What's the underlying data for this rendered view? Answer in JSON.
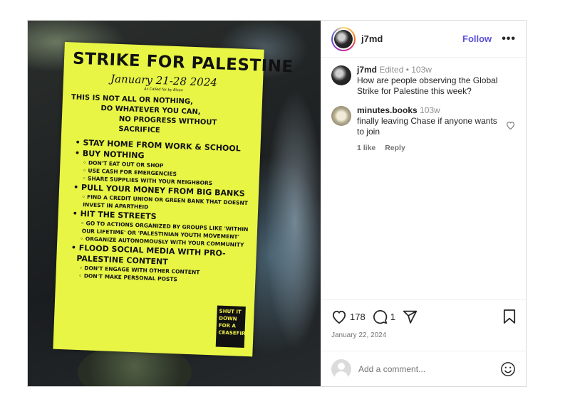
{
  "post": {
    "username": "j7md",
    "follow_label": "Follow",
    "more_label": "•••",
    "likes": "178",
    "comments_count": "1",
    "date": "January 22, 2024"
  },
  "flyer": {
    "title": "STRIKE FOR PALESTINE",
    "dates": "January 21-28 2024",
    "called_by": "As Called for by Bisan",
    "intro": [
      "THIS IS NOT ALL OR NOTHING,",
      "DO WHATEVER YOU CAN,",
      "NO PROGRESS WITHOUT SACRIFICE"
    ],
    "items": [
      "STAY HOME FROM WORK & SCHOOL",
      "BUY NOTHING",
      "DON'T EAT OUT OR SHOP",
      "USE CASH FOR EMERGENCIES",
      "SHARE SUPPLIES WITH YOUR NEIGHBORS",
      "PULL YOUR MONEY FROM BIG BANKS",
      "FIND A CREDIT UNION OR GREEN BANK THAT DOESNT",
      "INVEST IN APARTHEID",
      "HIT THE STREETS",
      "GO TO ACTIONS ORGANIZED BY GROUPS LIKE 'WITHIN",
      "OUR LIFETIME' OR 'PALESTINIAN YOUTH MOVEMENT'",
      "ORGANIZE AUTONOMOUSLY WITH YOUR COMMUNITY",
      "FLOOD SOCIAL MEDIA WITH PRO-",
      "PALESTINE CONTENT",
      "DON'T ENGAGE WITH OTHER CONTENT",
      "DON'T MAKE PERSONAL POSTS"
    ],
    "badge": "SHUT IT\nDOWN\nFOR A\nCEASEFIRE"
  },
  "comments": [
    {
      "user": "j7md",
      "meta": "Edited • 103w",
      "text": "How are people observing the Global Strike for Palestine this week?"
    },
    {
      "user": "minutes.books",
      "meta": "103w",
      "text": "finally leaving Chase if anyone wants to join",
      "likes_label": "1 like",
      "reply_label": "Reply"
    }
  ],
  "add_comment": {
    "placeholder": "Add a comment..."
  },
  "icons": [
    "heart-icon",
    "comment-icon",
    "share-icon",
    "bookmark-icon",
    "emoji-icon",
    "more-icon"
  ]
}
